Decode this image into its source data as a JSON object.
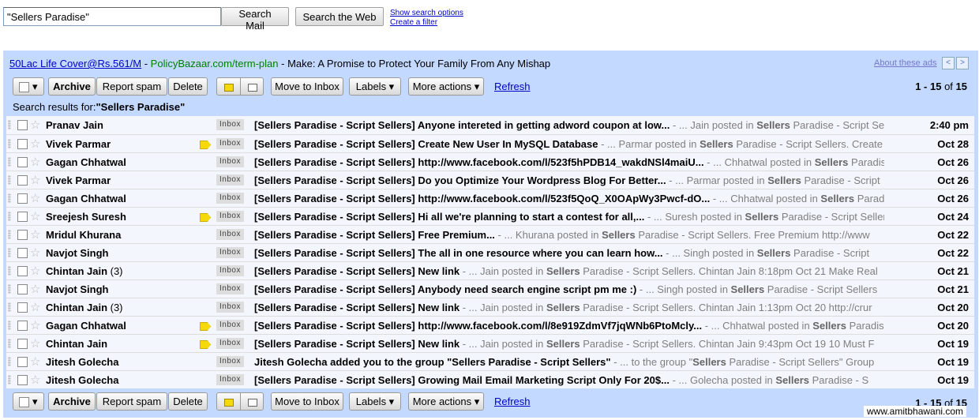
{
  "search": {
    "value": "\"Sellers Paradise\"",
    "search_mail": "Search Mail",
    "search_web": "Search the Web",
    "show_options": "Show search options",
    "create_filter": "Create a filter"
  },
  "ad": {
    "link": "50Lac Life Cover@Rs.561/M",
    "sep1": " - ",
    "url": "PolicyBazaar.com/term-plan",
    "text": " - Make: A Promise to Protect Your Family From Any Mishap",
    "about": "About these ads",
    "prev": "<",
    "next": ">"
  },
  "toolbar": {
    "select_arrow": "▾",
    "archive": "Archive",
    "report_spam": "Report spam",
    "delete": "Delete",
    "move_to_inbox": "Move to Inbox",
    "labels": "Labels ▾",
    "more_actions": "More actions ▾",
    "refresh": "Refresh",
    "page_range": "1 - 15",
    "page_of": " of ",
    "page_total": "15"
  },
  "results_label": {
    "prefix": "Search results for:",
    "query": "\"Sellers Paradise\""
  },
  "colors": {
    "frame": "#c3d9ff",
    "link": "#0000cc",
    "ad_url": "#008000",
    "important": "#f5d90a"
  },
  "emails": [
    {
      "sender": "Pranav Jain",
      "count": "",
      "important": false,
      "label": "Inbox",
      "subject": "[Sellers Paradise - Script Sellers] Anyone intereted in getting adword coupon at low...",
      "snippet_pre": " - ... Jain posted in ",
      "snippet_bold": "Sellers",
      "snippet_post": " Paradise - Script Sellers. Anyone",
      "date": "2:40 pm"
    },
    {
      "sender": "Vivek Parmar",
      "count": "",
      "important": true,
      "label": "Inbox",
      "subject": "[Sellers Paradise - Script Sellers] Create New User In MySQL Database",
      "snippet_pre": " - ... Parmar posted in ",
      "snippet_bold": "Sellers",
      "snippet_post": " Paradise - Script Sellers. Create New",
      "date": "Oct 28"
    },
    {
      "sender": "Gagan Chhatwal",
      "count": "",
      "important": false,
      "label": "Inbox",
      "subject": "[Sellers Paradise - Script Sellers] http://www.facebook.com/l/523f5hPDB14_wakdNSl4maiU...",
      "snippet_pre": " - ... Chhatwal posted in ",
      "snippet_bold": "Sellers",
      "snippet_post": " Paradise",
      "date": "Oct 26"
    },
    {
      "sender": "Vivek Parmar",
      "count": "",
      "important": false,
      "label": "Inbox",
      "subject": "[Sellers Paradise - Script Sellers] Do you Optimize Your Wordpress Blog For Better...",
      "snippet_pre": " - ... Parmar posted in ",
      "snippet_bold": "Sellers",
      "snippet_post": " Paradise - Script",
      "date": "Oct 26"
    },
    {
      "sender": "Gagan Chhatwal",
      "count": "",
      "important": false,
      "label": "Inbox",
      "subject": "[Sellers Paradise - Script Sellers] http://www.facebook.com/l/523f5QoQ_X0OApWy3Pwcf-dO...",
      "snippet_pre": " - ... Chhatwal posted in ",
      "snippet_bold": "Sellers",
      "snippet_post": " Paradise",
      "date": "Oct 26"
    },
    {
      "sender": "Sreejesh Suresh",
      "count": "",
      "important": true,
      "label": "Inbox",
      "subject": "[Sellers Paradise - Script Sellers] Hi all we're planning to start a contest for all,...",
      "snippet_pre": " - ... Suresh posted in ",
      "snippet_bold": "Sellers",
      "snippet_post": " Paradise - Script Sellers",
      "date": "Oct 24"
    },
    {
      "sender": "Mridul Khurana",
      "count": "",
      "important": false,
      "label": "Inbox",
      "subject": "[Sellers Paradise - Script Sellers] Free Premium...",
      "snippet_pre": " - ... Khurana posted in ",
      "snippet_bold": "Sellers",
      "snippet_post": " Paradise - Script Sellers. Free Premium http://www",
      "date": "Oct 22"
    },
    {
      "sender": "Navjot Singh",
      "count": "",
      "important": false,
      "label": "Inbox",
      "subject": "[Sellers Paradise - Script Sellers] The all in one resource where you can learn how...",
      "snippet_pre": " - ... Singh posted in ",
      "snippet_bold": "Sellers",
      "snippet_post": " Paradise - Script",
      "date": "Oct 22"
    },
    {
      "sender": "Chintan Jain",
      "count": " (3)",
      "important": false,
      "label": "Inbox",
      "subject": "[Sellers Paradise - Script Sellers] New link",
      "snippet_pre": " - ... Jain posted in ",
      "snippet_bold": "Sellers",
      "snippet_post": " Paradise - Script Sellers. Chintan Jain 8:18pm Oct 21 Make Real",
      "date": "Oct 21"
    },
    {
      "sender": "Navjot Singh",
      "count": "",
      "important": false,
      "label": "Inbox",
      "subject": "[Sellers Paradise - Script Sellers] Anybody need search engine script pm me :)",
      "snippet_pre": " - ... Singh posted in ",
      "snippet_bold": "Sellers",
      "snippet_post": " Paradise - Script Sellers",
      "date": "Oct 21"
    },
    {
      "sender": "Chintan Jain",
      "count": " (3)",
      "important": false,
      "label": "Inbox",
      "subject": "[Sellers Paradise - Script Sellers] New link",
      "snippet_pre": " - ... Jain posted in ",
      "snippet_bold": "Sellers",
      "snippet_post": " Paradise - Script Sellers. Chintan Jain 1:13pm Oct 20 http://crur",
      "date": "Oct 20"
    },
    {
      "sender": "Gagan Chhatwal",
      "count": "",
      "important": true,
      "label": "Inbox",
      "subject": "[Sellers Paradise - Script Sellers] http://www.facebook.com/l/8e919ZdmVf7jqWNb6PtoMcly...",
      "snippet_pre": " - ... Chhatwal posted in ",
      "snippet_bold": "Sellers",
      "snippet_post": " Paradise",
      "date": "Oct 20"
    },
    {
      "sender": "Chintan Jain",
      "count": "",
      "important": true,
      "label": "Inbox",
      "subject": "[Sellers Paradise - Script Sellers] New link",
      "snippet_pre": " - ... Jain posted in ",
      "snippet_bold": "Sellers",
      "snippet_post": " Paradise - Script Sellers. Chintan Jain 9:43pm Oct 19 10 Must F",
      "date": "Oct 19"
    },
    {
      "sender": "Jitesh Golecha",
      "count": "",
      "important": false,
      "label": "Inbox",
      "subject": "Jitesh Golecha added you to the group \"Sellers Paradise - Script Sellers\"",
      "snippet_pre": " - ... to the group \"",
      "snippet_bold": "Sellers",
      "snippet_post": " Paradise - Script Sellers\" Group",
      "date": "Oct 19"
    },
    {
      "sender": "Jitesh Golecha",
      "count": "",
      "important": false,
      "label": "Inbox",
      "subject": "[Sellers Paradise - Script Sellers] Growing Mail Email Marketing Script Only For 20$...",
      "snippet_pre": " - ... Golecha posted in ",
      "snippet_bold": "Sellers",
      "snippet_post": " Paradise - S",
      "date": "Oct 19"
    }
  ],
  "watermark": "www.amitbhawani.com"
}
